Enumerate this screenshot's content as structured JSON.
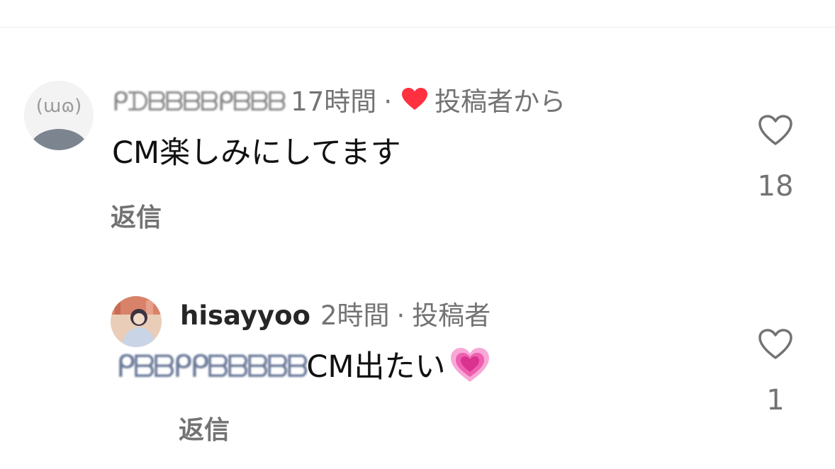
{
  "comments": [
    {
      "username": "ᑭᗪᗷᗷᗷᗷᑭᗷᗷᗷ",
      "time": "17時間",
      "separator": "·",
      "badge_label": "投稿者から",
      "badge_icon": "heart-icon",
      "badge_color": "#ff3040",
      "text": "CM楽しみにしてます",
      "reply_label": "返信",
      "likes": "18"
    },
    {
      "username": "hisayyoo",
      "time": "2時間",
      "separator": "·",
      "author_label": "投稿者",
      "mention": "ᑭᗷᗷᑭᑭᗷᗷᗷᗷᗷ",
      "text": "CM出たい",
      "emoji": "growing-heart-icon",
      "reply_label": "返信",
      "likes": "1"
    }
  ]
}
